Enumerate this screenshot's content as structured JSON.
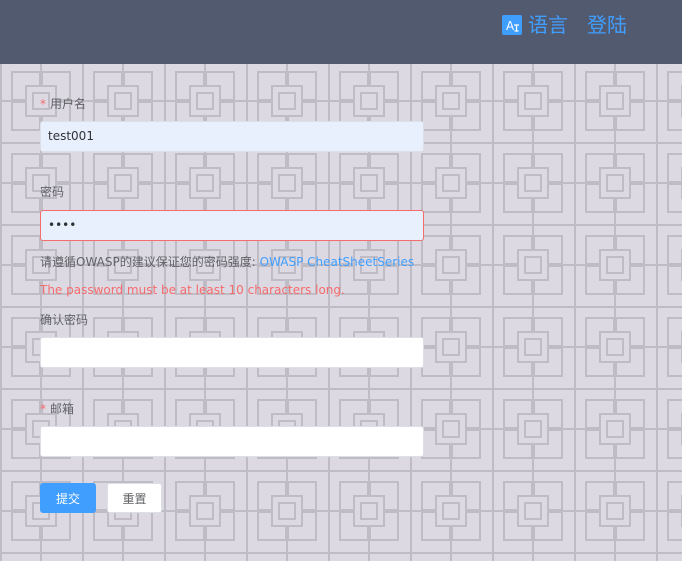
{
  "header": {
    "language_label": "语言",
    "language_icon_text": "A",
    "login_label": "登陆",
    "accent_color": "#409eff",
    "background_color": "#525a70"
  },
  "form": {
    "username": {
      "label": "用户名",
      "required_mark": "*",
      "value": "test001"
    },
    "password": {
      "label": "密码",
      "value": "••••"
    },
    "password_hint": {
      "text": "请遵循OWASP的建议保证您的密码强度:",
      "link_text": "OWASP CheatSheetSeries"
    },
    "password_error": "The password must be at least 10 characters long.",
    "confirm_password": {
      "label": "确认密码",
      "value": ""
    },
    "email": {
      "label": "邮箱",
      "required_mark": "*",
      "value": ""
    },
    "submit_label": "提交",
    "reset_label": "重置",
    "error_color": "#f56c6c"
  }
}
